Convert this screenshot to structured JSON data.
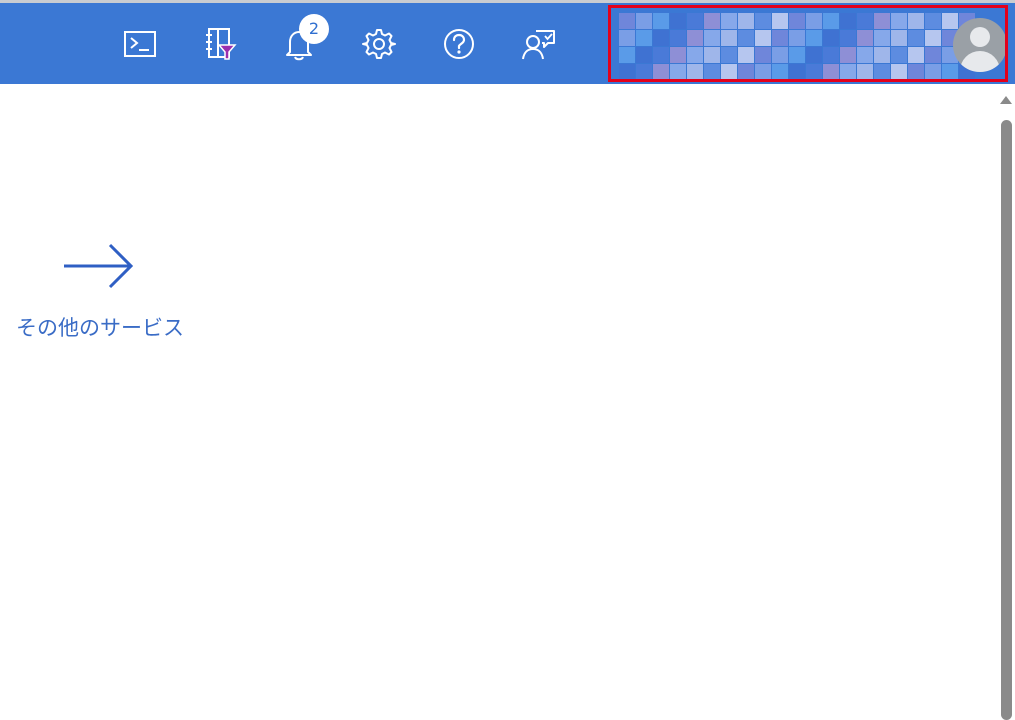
{
  "header": {
    "icons": [
      {
        "name": "cloud-shell-icon",
        "glyph": "terminal"
      },
      {
        "name": "directory-filter-icon",
        "glyph": "book-filter"
      },
      {
        "name": "notifications-icon",
        "glyph": "bell"
      },
      {
        "name": "settings-icon",
        "glyph": "gear"
      },
      {
        "name": "help-icon",
        "glyph": "question"
      },
      {
        "name": "feedback-icon",
        "glyph": "person-feedback"
      }
    ],
    "notification_count": "2",
    "account": {
      "obscured": true,
      "avatar_icon": "user-avatar-icon"
    }
  },
  "main": {
    "more_services_label": "その他のサービス",
    "more_services_icon": "arrow-right-icon"
  },
  "colors": {
    "topbar": "#3b78d4",
    "highlight_border": "#e3001b",
    "link_text": "#3a6cc6",
    "arrow": "#2f5fc4"
  }
}
